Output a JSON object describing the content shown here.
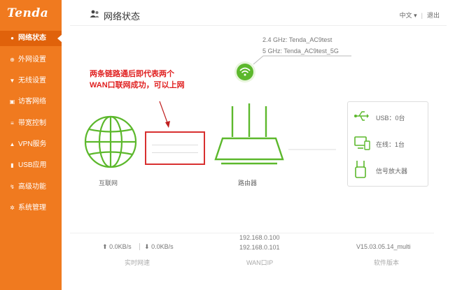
{
  "brand": {
    "logo": "Tenda",
    "accent": "#f07a1f",
    "green": "#5cb82c",
    "red": "#e02020"
  },
  "sidebar": {
    "items": [
      {
        "label": "网络状态",
        "icon": "people-icon",
        "active": true
      },
      {
        "label": "外网设置",
        "icon": "globe-icon",
        "active": false
      },
      {
        "label": "无线设置",
        "icon": "wifi-icon",
        "active": false
      },
      {
        "label": "访客网络",
        "icon": "guest-icon",
        "active": false
      },
      {
        "label": "带宽控制",
        "icon": "bandwidth-icon",
        "active": false
      },
      {
        "label": "VPN服务",
        "icon": "vpn-icon",
        "active": false
      },
      {
        "label": "USB应用",
        "icon": "usb-icon",
        "active": false
      },
      {
        "label": "高级功能",
        "icon": "advanced-icon",
        "active": false
      },
      {
        "label": "系统管理",
        "icon": "gear-icon",
        "active": false
      }
    ]
  },
  "header": {
    "title": "网络状态",
    "language": "中文",
    "logout": "退出"
  },
  "wifi": {
    "ssid_24": "2.4 GHz: Tenda_AC9test",
    "ssid_5": "5 GHz: Tenda_AC9test_5G"
  },
  "annotation": {
    "line1": "两条链路通后即代表两个",
    "line2": "WAN口联网成功，可以上网"
  },
  "topology": {
    "internet_label": "互联网",
    "router_label": "路由器"
  },
  "devices": {
    "usb": "USB：0台",
    "online": "在线：1台",
    "extender": "信号放大器"
  },
  "footer": {
    "upload": "0.0KB/s",
    "download": "0.0KB/s",
    "speed_label": "实时网速",
    "wan_ip1": "192.168.0.100",
    "wan_ip2": "192.168.0.101",
    "wan_label": "WAN口IP",
    "version": "V15.03.05.14_multi",
    "version_label": "软件版本"
  }
}
